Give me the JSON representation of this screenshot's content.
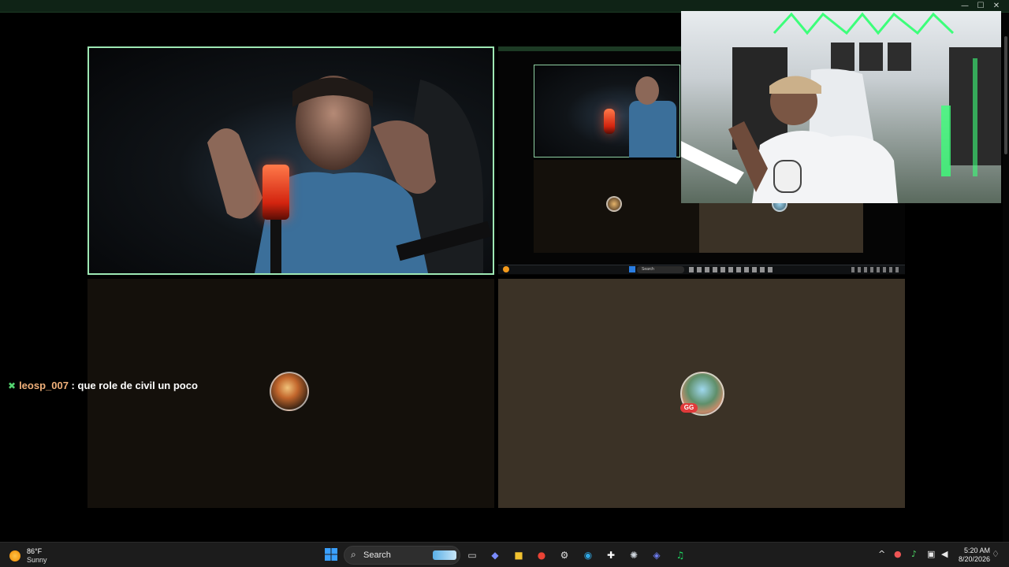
{
  "window": {
    "controls": [
      "—",
      "☐",
      "✕"
    ]
  },
  "chat": {
    "badge_icon": "verified-k-icon",
    "username": "leosp_007",
    "separator": " : ",
    "message": "que role de civil un poco"
  },
  "participants": [
    {
      "name": "participant-camera-main",
      "speaking": true
    },
    {
      "name": "participant-screen-share"
    },
    {
      "name": "participant-avatar-1"
    },
    {
      "name": "participant-avatar-2"
    }
  ],
  "mini_taskbar": {
    "search_label": "Search"
  },
  "taskbar": {
    "weather": {
      "temp": "86°F",
      "condition": "Sunny",
      "icon": "sun-icon"
    },
    "search_label": "Search",
    "apps": [
      {
        "name": "task-view-icon",
        "glyph": "▭",
        "color": "#cfcfcf"
      },
      {
        "name": "copilot-icon",
        "glyph": "◆",
        "color": "#7a8cff"
      },
      {
        "name": "file-explorer-icon",
        "glyph": "■",
        "color": "#f2c230"
      },
      {
        "name": "chrome-icon",
        "glyph": "●",
        "color": "#e94335"
      },
      {
        "name": "tool-app-icon",
        "glyph": "⚙",
        "color": "#e0e0e0"
      },
      {
        "name": "edge-icon",
        "glyph": "◉",
        "color": "#2fa7e4"
      },
      {
        "name": "capture-app-icon",
        "glyph": "✚",
        "color": "#ffffff"
      },
      {
        "name": "steam-icon",
        "glyph": "✺",
        "color": "#cfd6dd"
      },
      {
        "name": "discord-icon",
        "glyph": "◈",
        "color": "#6d7cf0"
      },
      {
        "name": "spotify-icon",
        "glyph": "♫",
        "color": "#1ed760"
      }
    ],
    "tray": {
      "chevron": "^",
      "clock_time": "5:20 AM",
      "clock_date": "8/20/2026"
    }
  },
  "colors": {
    "active_border": "#9ee8b4",
    "tile_dark": "#14100b",
    "tile_light": "#3b3226"
  }
}
